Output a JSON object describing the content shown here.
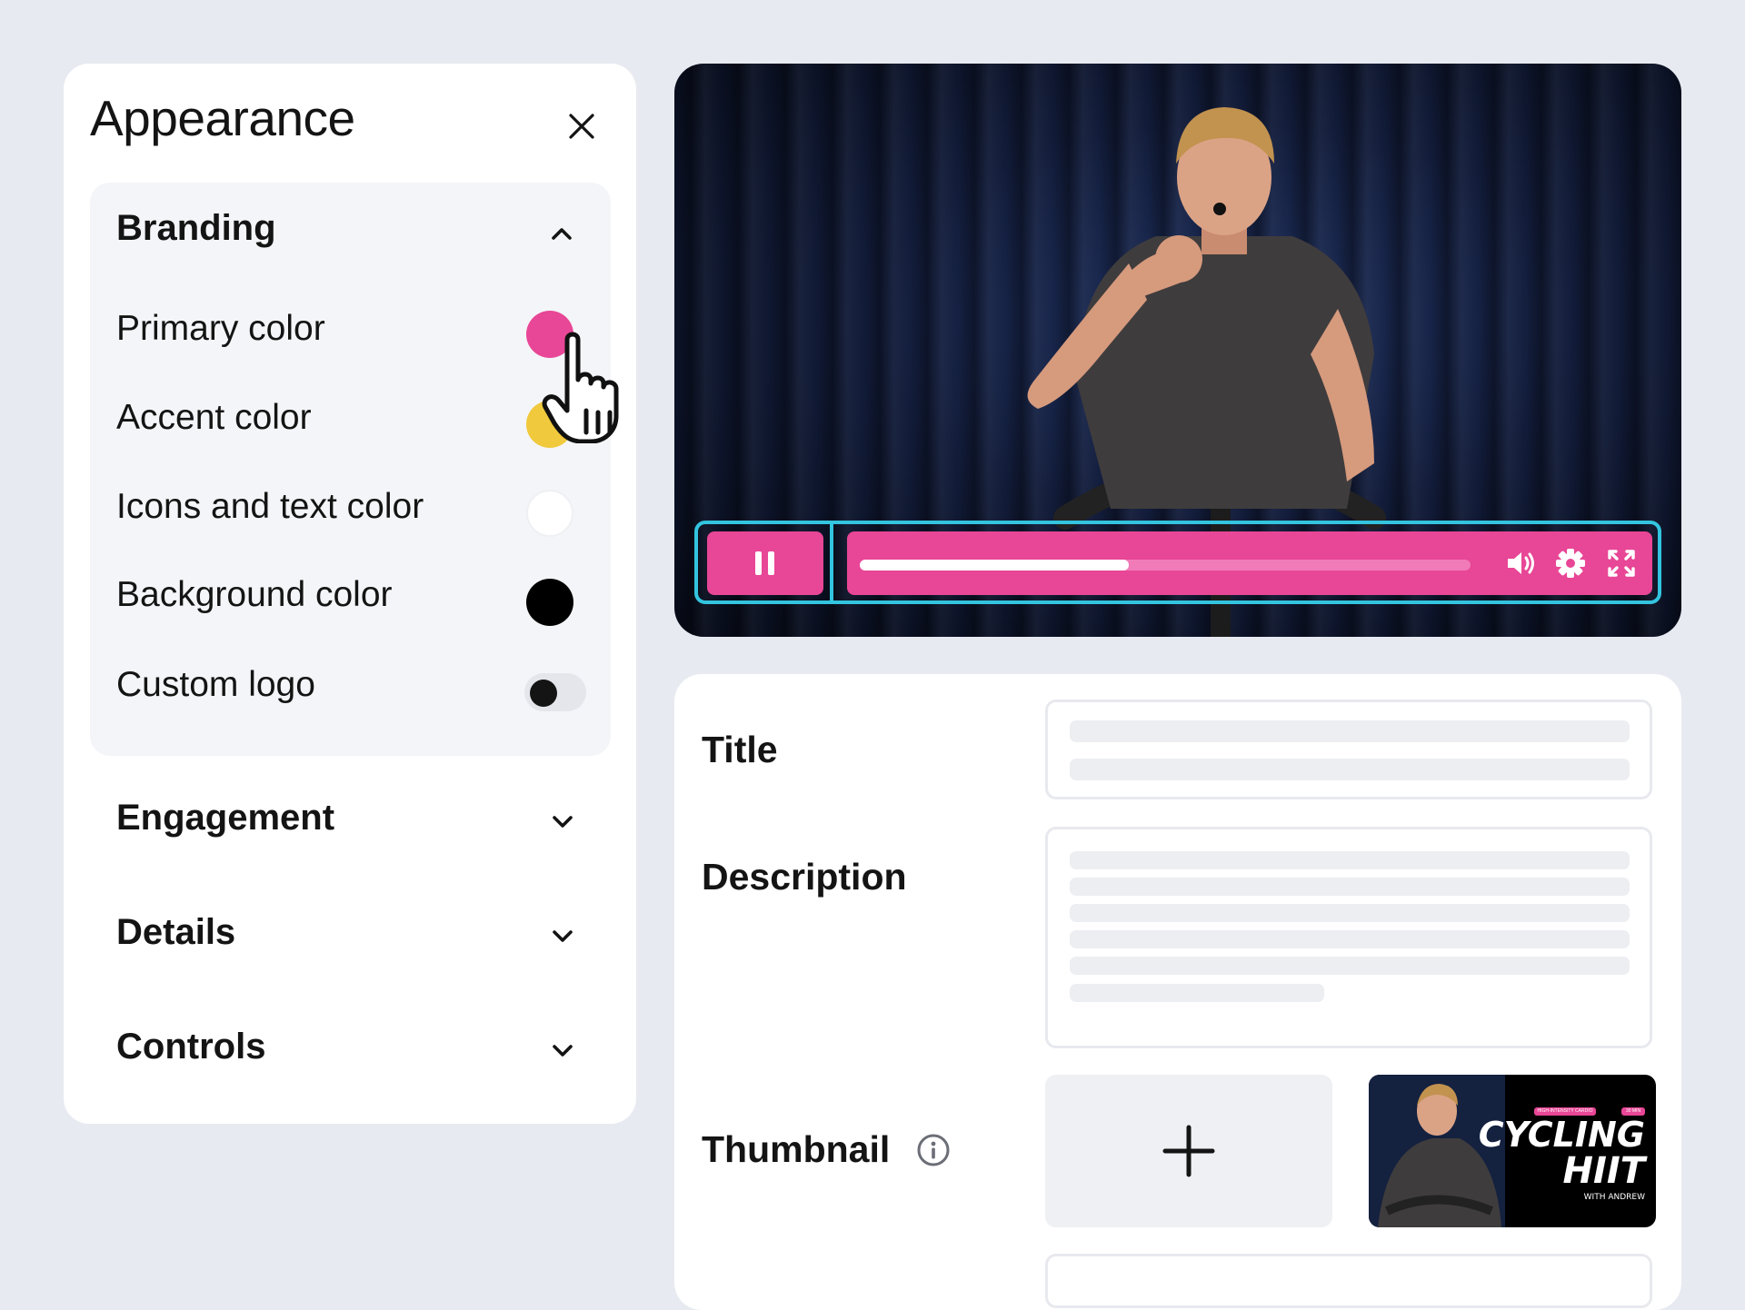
{
  "panel": {
    "title": "Appearance",
    "close_icon": "close-icon",
    "sections": [
      {
        "label": "Branding",
        "expanded": true
      },
      {
        "label": "Engagement",
        "expanded": false
      },
      {
        "label": "Details",
        "expanded": false
      },
      {
        "label": "Controls",
        "expanded": false
      }
    ],
    "branding": {
      "primary_label": "Primary color",
      "primary_color": "#e84696",
      "accent_label": "Accent color",
      "accent_color": "#f0c93c",
      "icons_text_label": "Icons and text color",
      "icons_text_color": "#ffffff",
      "background_label": "Background color",
      "background_color": "#000000",
      "logo_label": "Custom logo",
      "logo_enabled": false
    }
  },
  "player": {
    "progress": 0.44,
    "primary_color": "#e84696",
    "outline_color": "#33c4df",
    "icons": [
      "pause-icon",
      "volume-icon",
      "settings-gear-icon",
      "fullscreen-icon"
    ]
  },
  "details": {
    "title_label": "Title",
    "description_label": "Description",
    "thumbnail_label": "Thumbnail",
    "thumbnail": {
      "badge_left": "HIGH-INTENSITY CARDIO",
      "badge_right": "30 MIN",
      "line1": "CYCLING",
      "line2": "HIIT",
      "subtitle": "WITH ANDREW"
    }
  }
}
